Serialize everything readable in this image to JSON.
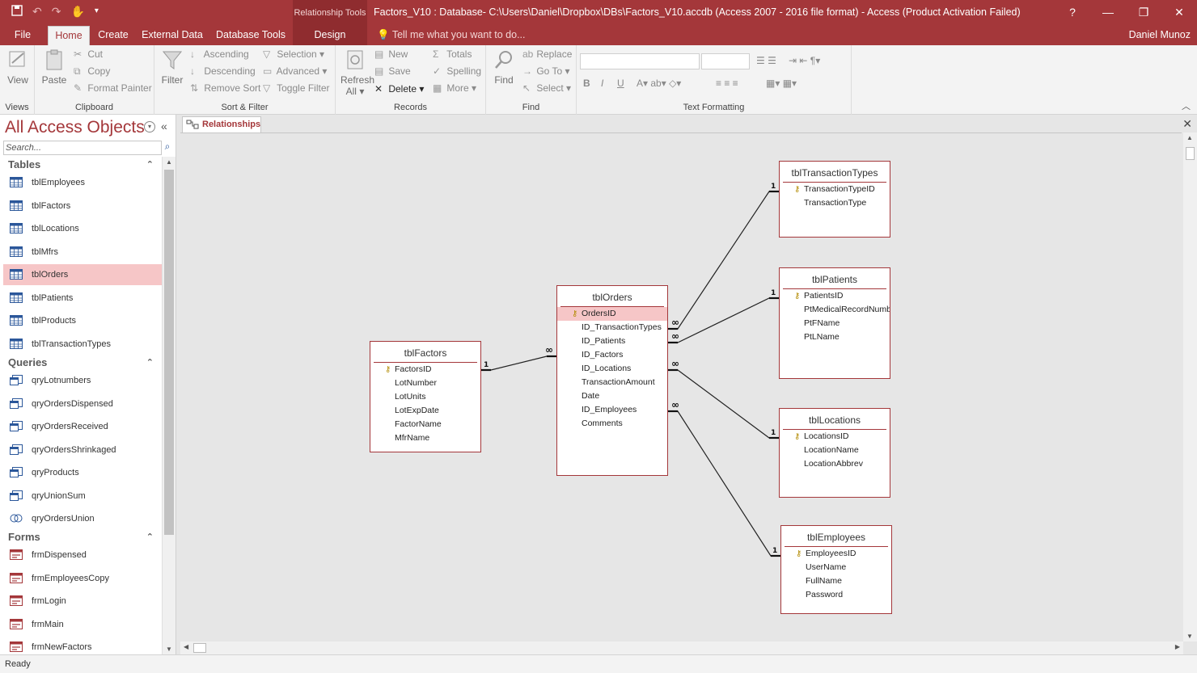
{
  "titlebar": {
    "context_tools": "Relationship Tools",
    "title": "Factors_V10 : Database- C:\\Users\\Daniel\\Dropbox\\DBs\\Factors_V10.accdb (Access 2007 - 2016 file format) - Access (Product Activation Failed)",
    "help": "?",
    "minimize": "—",
    "restore": "❐",
    "close": "✕"
  },
  "tabs": [
    {
      "label": "File"
    },
    {
      "label": "Home"
    },
    {
      "label": "Create"
    },
    {
      "label": "External Data"
    },
    {
      "label": "Database Tools"
    },
    {
      "label": "Design"
    }
  ],
  "tellme": "Tell me what you want to do...",
  "user": "Daniel Munoz",
  "ribbon": {
    "views": {
      "view": "View",
      "label": "Views"
    },
    "clipboard": {
      "paste": "Paste",
      "cut": "Cut",
      "copy": "Copy",
      "format_painter": "Format Painter",
      "label": "Clipboard"
    },
    "sortfilter": {
      "filter": "Filter",
      "ascending": "Ascending",
      "descending": "Descending",
      "remove_sort": "Remove Sort",
      "selection": "Selection",
      "advanced": "Advanced",
      "toggle_filter": "Toggle Filter",
      "label": "Sort & Filter"
    },
    "records": {
      "refresh": "Refresh",
      "refresh2": "All",
      "new": "New",
      "save": "Save",
      "delete": "Delete",
      "totals": "Totals",
      "spelling": "Spelling",
      "more": "More",
      "label": "Records"
    },
    "find": {
      "find": "Find",
      "replace": "Replace",
      "goto": "Go To",
      "select": "Select",
      "label": "Find"
    },
    "textformatting": {
      "label": "Text Formatting",
      "bold": "B",
      "italic": "I",
      "underline": "U"
    }
  },
  "nav": {
    "title": "All Access Objects",
    "search_placeholder": "Search...",
    "sections": [
      {
        "label": "Tables",
        "items": [
          "tblEmployees",
          "tblFactors",
          "tblLocations",
          "tblMfrs",
          "tblOrders",
          "tblPatients",
          "tblProducts",
          "tblTransactionTypes"
        ],
        "selected": "tblOrders"
      },
      {
        "label": "Queries",
        "items": [
          "qryLotnumbers",
          "qryOrdersDispensed",
          "qryOrdersReceived",
          "qryOrdersShrinkaged",
          "qryProducts",
          "qryUnionSum",
          "qryOrdersUnion"
        ]
      },
      {
        "label": "Forms",
        "items": [
          "frmDispensed",
          "frmEmployeesCopy",
          "frmLogin",
          "frmMain",
          "frmNewFactors"
        ]
      }
    ]
  },
  "document": {
    "tab_label": "Relationships",
    "tables": [
      {
        "name": "tblFactors",
        "fields": [
          "FactorsID",
          "LotNumber",
          "LotUnits",
          "LotExpDate",
          "FactorName",
          "MfrName"
        ],
        "key": "FactorsID"
      },
      {
        "name": "tblOrders",
        "fields": [
          "OrdersID",
          "ID_TransactionTypes",
          "ID_Patients",
          "ID_Factors",
          "ID_Locations",
          "TransactionAmount",
          "Date",
          "ID_Employees",
          "Comments"
        ],
        "key": "OrdersID",
        "selected": "OrdersID"
      },
      {
        "name": "tblTransactionTypes",
        "fields": [
          "TransactionTypeID",
          "TransactionType"
        ],
        "key": "TransactionTypeID"
      },
      {
        "name": "tblPatients",
        "fields": [
          "PatientsID",
          "PtMedicalRecordNumber",
          "PtFName",
          "PtLName"
        ],
        "key": "PatientsID"
      },
      {
        "name": "tblLocations",
        "fields": [
          "LocationsID",
          "LocationName",
          "LocationAbbrev"
        ],
        "key": "LocationsID"
      },
      {
        "name": "tblEmployees",
        "fields": [
          "EmployeesID",
          "UserName",
          "FullName",
          "Password"
        ],
        "key": "EmployeesID"
      }
    ],
    "rel_one": "1",
    "rel_many": "∞"
  },
  "status": "Ready",
  "colors": {
    "accent": "#a4373a",
    "selection": "#f6c6c7"
  }
}
